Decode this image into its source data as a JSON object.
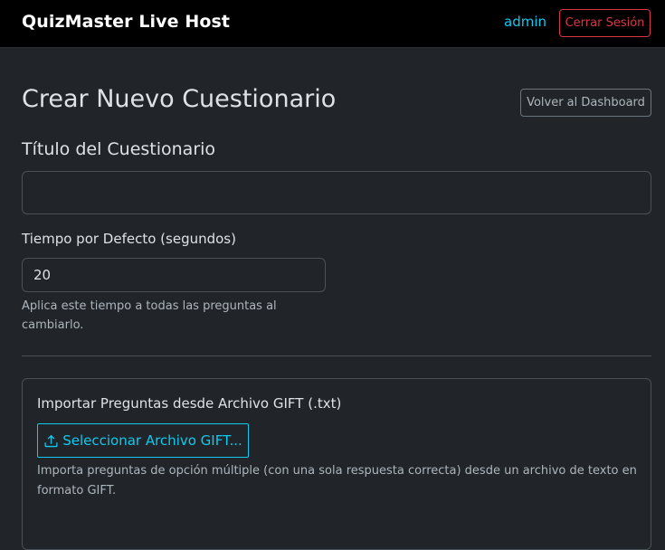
{
  "navbar": {
    "brand": "QuizMaster Live Host",
    "user": "admin",
    "logout_label": "Cerrar Sesión"
  },
  "page": {
    "title": "Crear Nuevo Cuestionario",
    "back_label": "Volver al Dashboard"
  },
  "form": {
    "title_label": "Título del Cuestionario",
    "title_value": "",
    "time_label": "Tiempo por Defecto (segundos)",
    "time_value": "20",
    "time_help": "Aplica este tiempo a todas las preguntas al cambiarlo."
  },
  "import": {
    "title": "Importar Preguntas desde Archivo GIFT (.txt)",
    "button_label": "Seleccionar Archivo GIFT...",
    "button_icon": "upload-icon",
    "help": "Importa preguntas de opción múltiple (con una sola respuesta correcta) desde un archivo de texto en formato GIFT."
  },
  "colors": {
    "background": "#212529",
    "navbar": "#000000",
    "accent_info": "#0dcaf0",
    "danger": "#dc3545",
    "secondary": "#6c757d"
  }
}
